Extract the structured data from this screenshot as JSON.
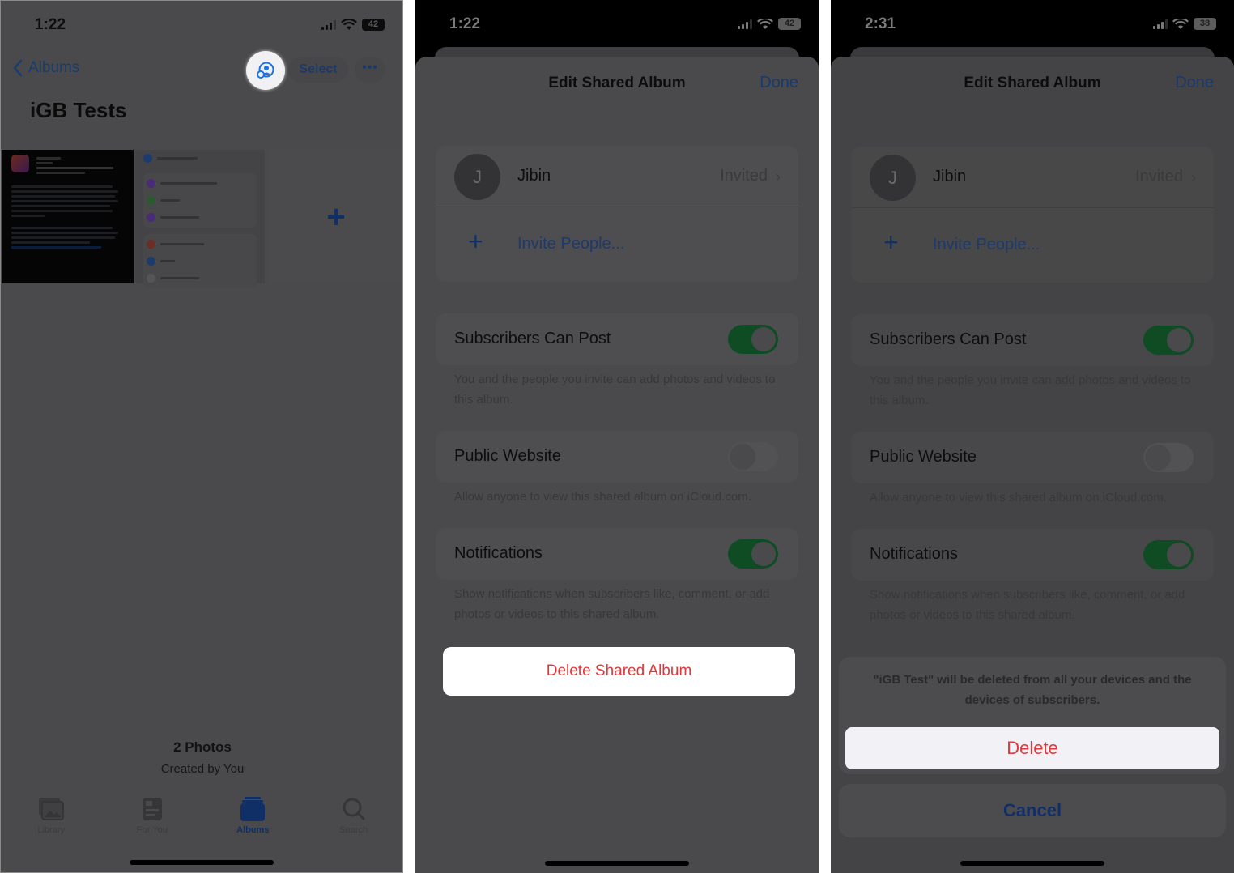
{
  "screens": [
    {
      "status": {
        "time": "1:22",
        "battery": "42"
      },
      "nav": {
        "back_label": "Albums",
        "select_label": "Select",
        "more_label": "•••"
      },
      "album_title": "iGB Tests",
      "add_tile_symbol": "+",
      "summary": {
        "count": "2 Photos",
        "creator": "Created by You"
      },
      "tabs": [
        {
          "label": "Library",
          "icon": "photo-library-icon",
          "active": false
        },
        {
          "label": "For You",
          "icon": "for-you-icon",
          "active": false
        },
        {
          "label": "Albums",
          "icon": "albums-icon",
          "active": true
        },
        {
          "label": "Search",
          "icon": "search-icon",
          "active": false
        }
      ]
    },
    {
      "status": {
        "time": "1:22",
        "battery": "42"
      },
      "sheet": {
        "title": "Edit Shared Album",
        "done_label": "Done"
      },
      "member": {
        "initial": "J",
        "name": "Jibin",
        "status": "Invited"
      },
      "invite_label": "Invite People...",
      "settings": [
        {
          "label": "Subscribers Can Post",
          "on": true,
          "footnote": "You and the people you invite can add photos and videos to this album."
        },
        {
          "label": "Public Website",
          "on": false,
          "footnote": "Allow anyone to view this shared album on iCloud.com."
        },
        {
          "label": "Notifications",
          "on": true,
          "footnote": "Show notifications when subscribers like, comment, or add photos or videos to this shared album."
        }
      ],
      "delete_label": "Delete Shared Album"
    },
    {
      "status": {
        "time": "2:31",
        "battery": "38"
      },
      "sheet": {
        "title": "Edit Shared Album",
        "done_label": "Done"
      },
      "member": {
        "initial": "J",
        "name": "Jibin",
        "status": "Invited"
      },
      "invite_label": "Invite People...",
      "settings": [
        {
          "label": "Subscribers Can Post",
          "on": true,
          "footnote": "You and the people you invite can add photos and videos to this album."
        },
        {
          "label": "Public Website",
          "on": false,
          "footnote": "Allow anyone to view this shared album on iCloud.com."
        },
        {
          "label": "Notifications",
          "on": true,
          "footnote": "Show notifications when subscribers like, comment, or add photos or videos to this shared album."
        }
      ],
      "action_sheet": {
        "message": "\"iGB Test\" will be deleted from all your devices and the devices of subscribers.",
        "delete_label": "Delete",
        "cancel_label": "Cancel"
      }
    }
  ],
  "colors": {
    "ios_blue_dimmed": "#1d3a6b",
    "destructive_red": "#e3373b",
    "switch_on_dimmed": "#0f4b23",
    "dim_background": "#4a4a4c"
  }
}
